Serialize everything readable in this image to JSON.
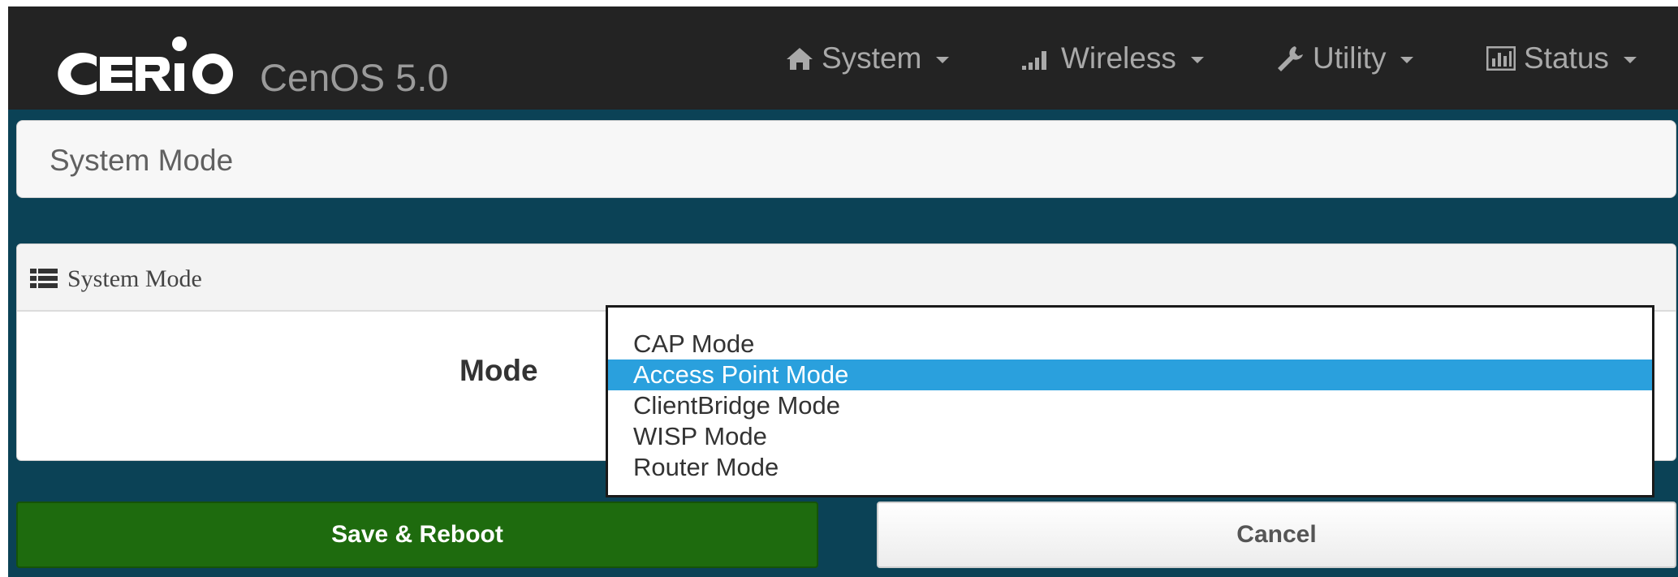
{
  "header": {
    "logo_text": "CERIO",
    "product": "CenOS 5.0",
    "menu": [
      {
        "label": "System",
        "icon": "home-icon"
      },
      {
        "label": "Wireless",
        "icon": "signal-bars-icon"
      },
      {
        "label": "Utility",
        "icon": "wrench-icon"
      },
      {
        "label": "Status",
        "icon": "bar-chart-icon"
      }
    ]
  },
  "page": {
    "title": "System Mode"
  },
  "panel": {
    "heading": "System Mode",
    "heading_icon": "list-icon",
    "mode_label": "Mode",
    "mode_select": {
      "selected": "Access Point Mode",
      "options": [
        "CAP Mode",
        "Access Point Mode",
        "ClientBridge Mode",
        "WISP Mode",
        "Router Mode"
      ]
    }
  },
  "actions": {
    "save_label": "Save & Reboot",
    "cancel_label": "Cancel"
  },
  "colors": {
    "navbar": "#232323",
    "background": "#0b4256",
    "selected_option": "#2aa0dd",
    "save_button": "#1e6b0e"
  }
}
